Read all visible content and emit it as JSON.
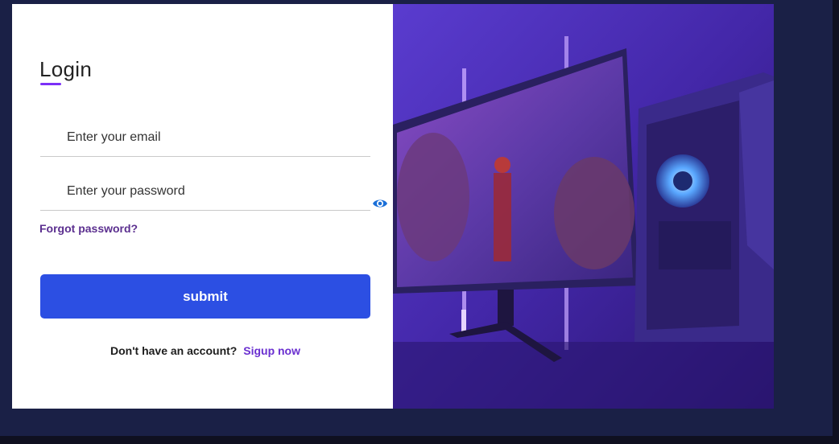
{
  "login": {
    "title": "Login",
    "email_placeholder": "Enter your email",
    "password_placeholder": "Enter your password",
    "forgot_label": "Forgot password?",
    "submit_label": "submit",
    "signup_prompt": "Don't have an account?",
    "signup_link": "Sigup now"
  },
  "icons": {
    "password_toggle": "eye-icon"
  },
  "colors": {
    "accent_underline": "#7b2ff7",
    "submit_bg": "#2c4fe3",
    "link": "#6a2fd0",
    "page_bg": "#1a2046"
  }
}
